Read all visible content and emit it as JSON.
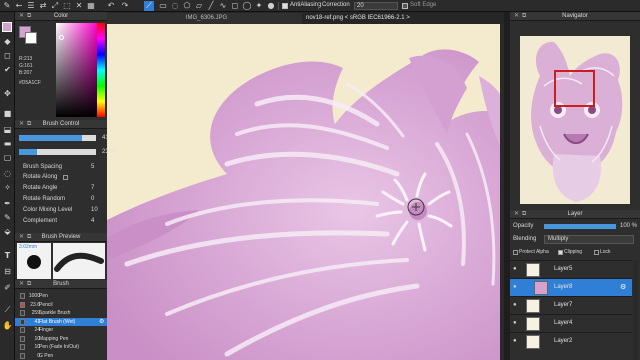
{
  "toolbar": {
    "antialiasing_label": "AntiAliasing",
    "correction_label": "Correction",
    "correction_value": "20",
    "soft_edge_label": "Soft Edge"
  },
  "tabs": [
    {
      "label": "IMG_6306.JPG"
    },
    {
      "label": "nov18-ref.png < sRGB IEC61966-2.1 >"
    }
  ],
  "color_panel": {
    "title": "Color",
    "r_value": "R:213",
    "g_value": "G:161",
    "b_value": "B:207",
    "hex_value": "#D5A1CF",
    "fg_color": "#d5a1cf",
    "bg_color": "#ffffff"
  },
  "brush_control": {
    "title": "Brush Control",
    "size_value": "41",
    "size_fraction": 0.82,
    "opacity_value": "23 %",
    "opacity_fraction": 0.23,
    "params": [
      {
        "label": "Brush Spacing",
        "value": "5"
      },
      {
        "label": "Rotate Along",
        "value": ""
      },
      {
        "label": "Rotate Angle",
        "value": "7"
      },
      {
        "label": "Rotate Random",
        "value": "0"
      },
      {
        "label": "Color Mixing Level",
        "value": "10"
      },
      {
        "label": "Complement",
        "value": "4"
      }
    ]
  },
  "brush_preview": {
    "title": "Brush Preview",
    "size_label": "3.02mm"
  },
  "brush_list": {
    "title": "Brush",
    "items": [
      {
        "num": "1000",
        "name": "Pen",
        "chip": "#3a3a3a",
        "selected": false
      },
      {
        "num": "23.6",
        "name": "Pencil",
        "chip": "#b55050",
        "selected": false
      },
      {
        "num": "259",
        "name": "Sparkle Brush",
        "chip": "#3a3a3a",
        "selected": false
      },
      {
        "num": "41",
        "name": "Flat Brush (Wet)",
        "chip": "#3a3a3a",
        "selected": true
      },
      {
        "num": "24",
        "name": "Finger",
        "chip": "#3a3a3a",
        "selected": false
      },
      {
        "num": "10",
        "name": "Mapping Pen",
        "chip": "#3a3a3a",
        "selected": false
      },
      {
        "num": "10",
        "name": "Pen (Fade In/Out)",
        "chip": "#3a3a3a",
        "selected": false
      },
      {
        "num": "0",
        "name": "G Pen",
        "chip": "#3a3a3a",
        "selected": false
      }
    ]
  },
  "navigator": {
    "title": "Navigator"
  },
  "layer_panel": {
    "title": "Layer",
    "opacity_label": "Opacity",
    "opacity_value": "100 %",
    "opacity_fraction": 1.0,
    "blending_label": "Blending",
    "blending_value": "Multiply",
    "protect_alpha_label": "Protect Alpha",
    "clipping_label": "Clipping",
    "lock_label": "Lock",
    "layers": [
      {
        "name": "Layer5",
        "selected": false
      },
      {
        "name": "Layer8",
        "selected": true
      },
      {
        "name": "Layer7",
        "selected": false
      },
      {
        "name": "Layer4",
        "selected": false
      },
      {
        "name": "Layer2",
        "selected": false
      }
    ]
  },
  "colors": {
    "accent": "#2f7fd6",
    "canvas_bg": "#f4ebcf",
    "paint": "#d5a1cf"
  }
}
